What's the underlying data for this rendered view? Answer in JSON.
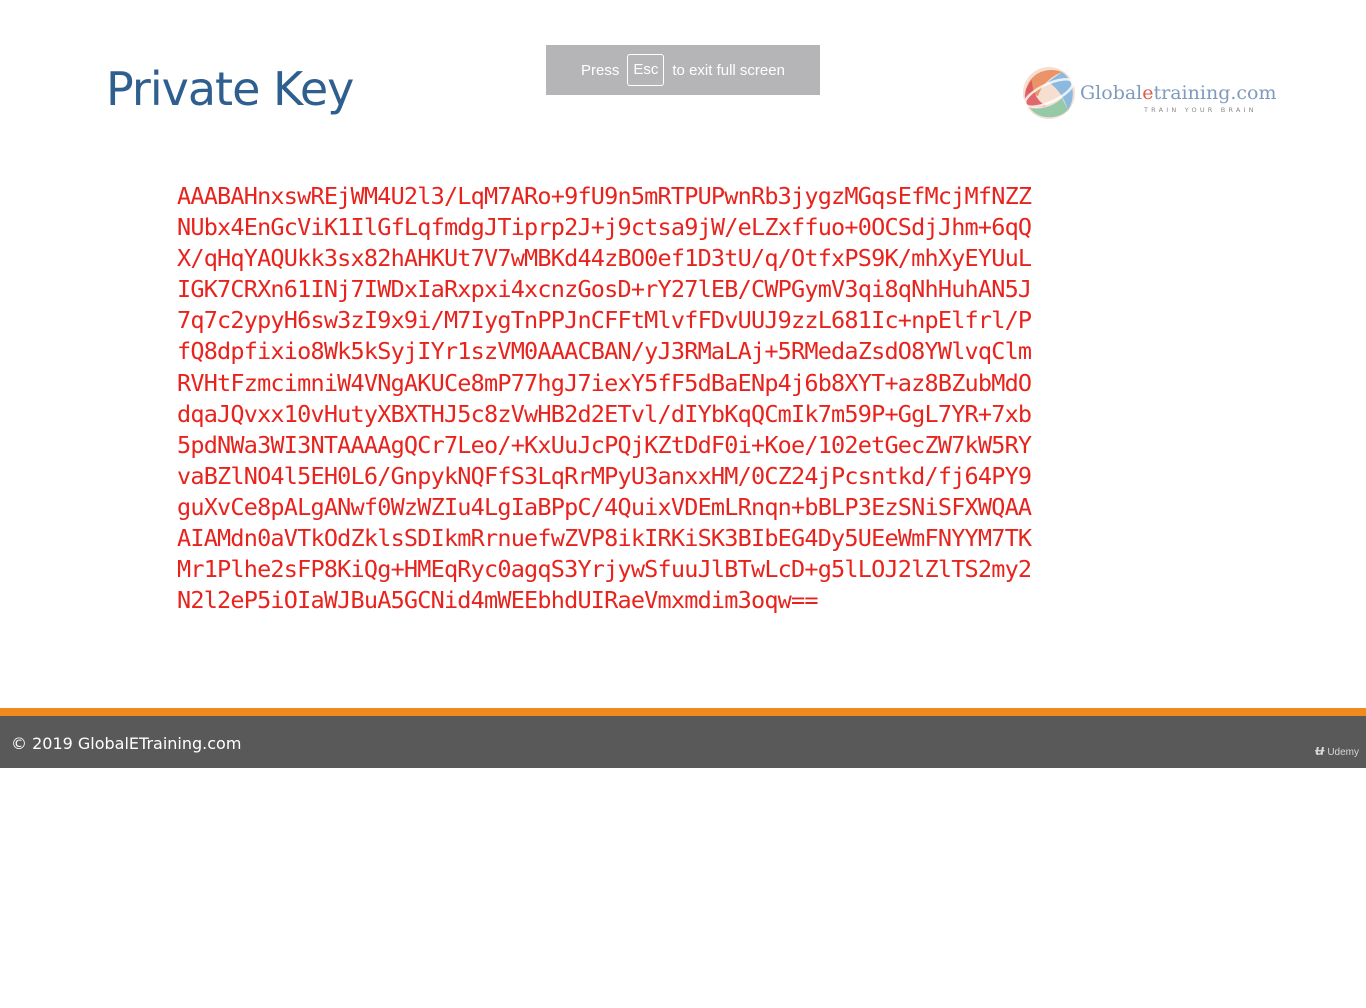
{
  "slide": {
    "title": "Private Key",
    "logo": {
      "name_prefix": "Global",
      "name_accent": "e",
      "name_suffix": "training.com",
      "tagline": "TRAIN YOUR BRAIN"
    },
    "key_lines": [
      "AAABAHnxswREjWM4U2l3/LqM7ARo+9fU9n5mRTPUPwnRb3jygzMGqsEfMcjMfNZZ",
      "NUbx4EnGcViK1IlGfLqfmdgJTiprp2J+j9ctsa9jW/eLZxffuo+0OCSdjJhm+6qQ",
      "X/qHqYAQUkk3sx82hAHKUt7V7wMBKd44zBO0ef1D3tU/q/OtfxPS9K/mhXyEYUuL",
      "IGK7CRXn61INj7IWDxIaRxpxi4xcnzGosD+rY27lEB/CWPGymV3qi8qNhHuhAN5J",
      "7q7c2ypyH6sw3zI9x9i/M7IygTnPPJnCFFtMlvfFDvUUJ9zzL681Ic+npElfrl/P",
      "fQ8dpfixio8Wk5kSyjIYr1szVM0AAACBAN/yJ3RMaLAj+5RMedaZsdO8YWlvqClm",
      "RVHtFzmcimniW4VNgAKUCe8mP77hgJ7iexY5fF5dBaENp4j6b8XYT+az8BZubMdO",
      "dqaJQvxx10vHutyXBXTHJ5c8zVwHB2d2ETvl/dIYbKqQCmIk7m59P+GgL7YR+7xb",
      "5pdNWa3WI3NTAAAAgQCr7Leo/+KxUuJcPQjKZtDdF0i+Koe/102etGecZW7kW5RY",
      "vaBZlNO4l5EH0L6/GnpykNQFfS3LqRrMPyU3anxxHM/0CZ24jPcsntkd/fj64PY9",
      "guXvCe8pALgANwf0WzWZIu4LgIaBPpC/4QuixVDEmLRnqn+bBLP3EzSNiSFXWQAA",
      "AIAMdn0aVTkOdZklsSDIkmRrnuefwZVP8ikIRKiSK3BIbEG4Dy5UEeWmFNYYM7TK",
      "Mr1Plhe2sFP8KiQg+HMEqRyc0agqS3YrjywSfuuJlBTwLcD+g5lLOJ2lZlTS2my2",
      "N2l2eP5iOIaWJBuA5GCNid4mWEEbhdUIRaeVmxmdim3oqw=="
    ],
    "key_color": "#e8231d",
    "title_color": "#2f5f8f"
  },
  "fullscreen_notice": {
    "prefix": "Press",
    "key": "Esc",
    "suffix": "to exit full screen"
  },
  "footer": {
    "copyright": "© 2019 GlobalETraining.com",
    "brand_icon": "udemy-logo-icon",
    "brand_text": "Udemy",
    "stripe_color": "#ef8a1f",
    "bar_color": "#595959"
  }
}
